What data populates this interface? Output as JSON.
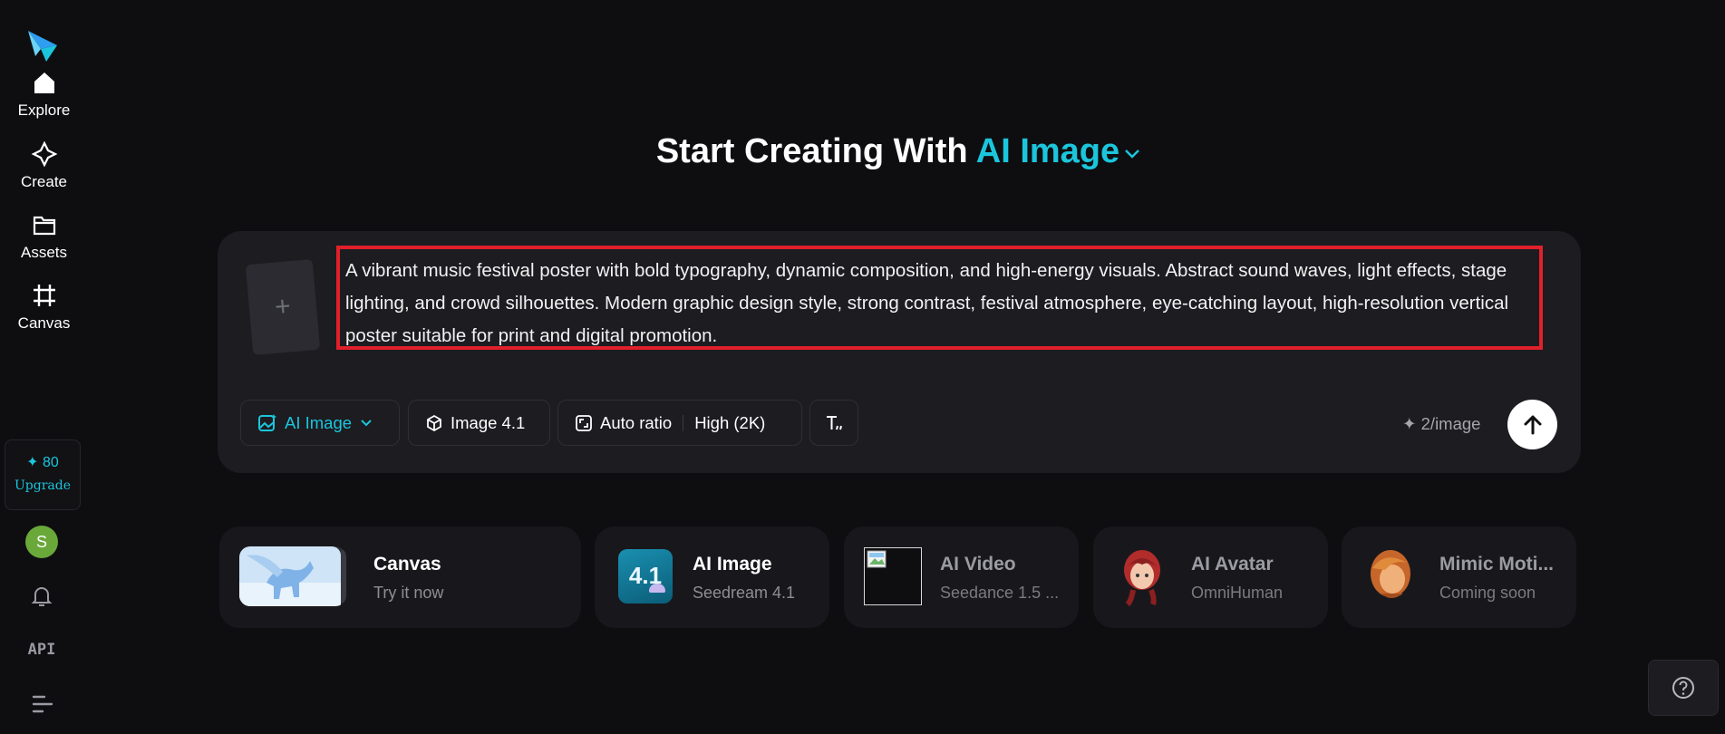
{
  "sidebar": {
    "nav": [
      {
        "label": "Explore",
        "icon": "home-icon"
      },
      {
        "label": "Create",
        "icon": "sparkle-icon"
      },
      {
        "label": "Assets",
        "icon": "folder-icon"
      },
      {
        "label": "Canvas",
        "icon": "crop-icon"
      }
    ],
    "upgrade": {
      "credits": "✦ 80",
      "label": "Upgrade"
    },
    "avatar_initial": "S",
    "api_label": "API"
  },
  "headline": {
    "prefix": "Start Creating With",
    "mode": "AI Image"
  },
  "prompt": {
    "text": "A vibrant music festival poster with bold typography, dynamic composition, and high-energy visuals. Abstract sound waves, light effects, stage lighting, and crowd silhouettes. Modern graphic design style, strong contrast, festival atmosphere, eye-catching layout, high-resolution vertical poster suitable for print and digital promotion.",
    "upload_symbol": "+"
  },
  "toolbar": {
    "mode_label": "AI Image",
    "model_label": "Image 4.1",
    "ratio_label": "Auto ratio",
    "quality_label": "High (2K)",
    "cost_label": "✦ 2/image"
  },
  "modes": [
    {
      "title": "Canvas",
      "subtitle": "Try it now"
    },
    {
      "title": "AI Image",
      "subtitle": "Seedream 4.1",
      "thumb_text": "4.1"
    },
    {
      "title": "AI Video",
      "subtitle": "Seedance 1.5 ..."
    },
    {
      "title": "AI Avatar",
      "subtitle": "OmniHuman"
    },
    {
      "title": "Mimic Moti...",
      "subtitle": "Coming soon"
    }
  ],
  "colors": {
    "accent": "#1bc6dc",
    "background": "#0e0e11",
    "card": "#1c1c21",
    "highlight_border": "#e0202a"
  }
}
